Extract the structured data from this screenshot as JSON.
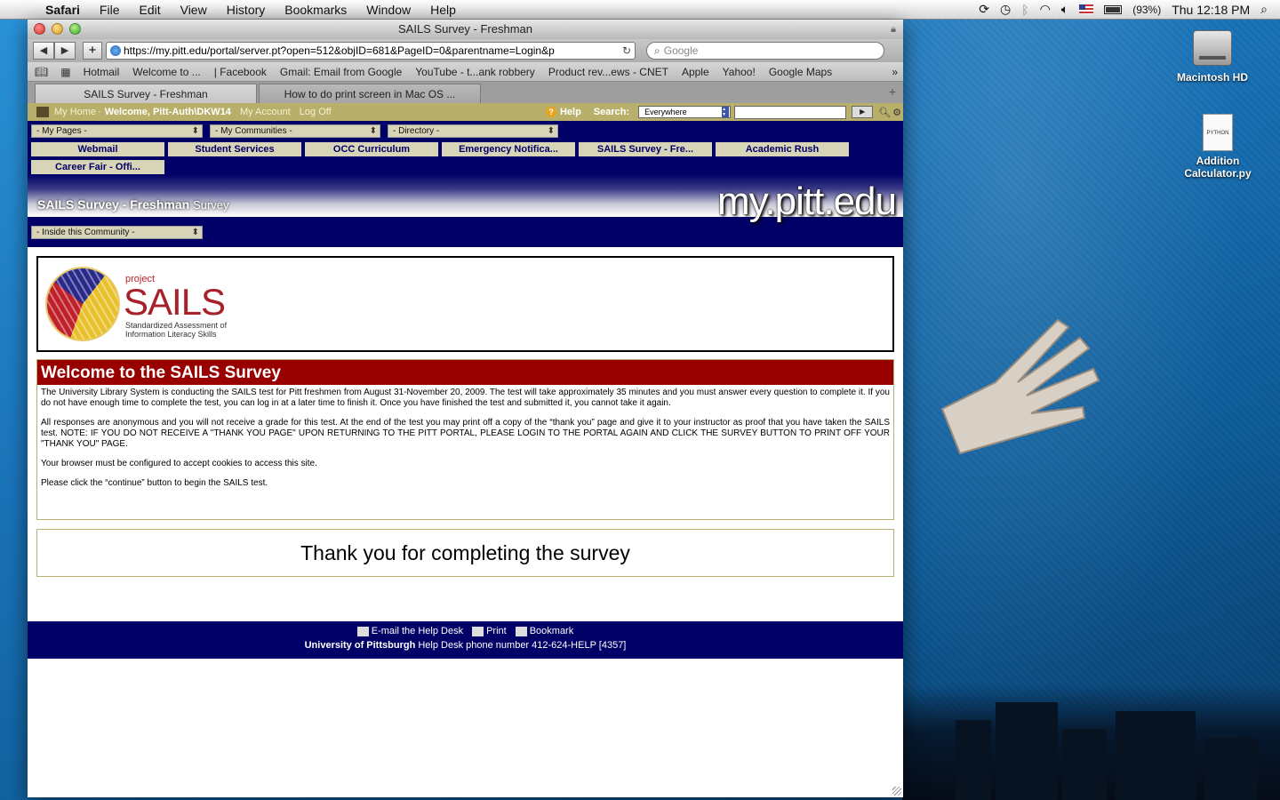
{
  "menubar": {
    "app_name": "Safari",
    "menus": [
      "File",
      "Edit",
      "View",
      "History",
      "Bookmarks",
      "Window",
      "Help"
    ],
    "battery": "(93%)",
    "clock": "Thu 12:18 PM"
  },
  "window": {
    "title": "SAILS Survey - Freshman",
    "url": "https://my.pitt.edu/portal/server.pt?open=512&objID=681&PageID=0&parentname=Login&p",
    "search_placeholder": "Google"
  },
  "bookmarks": [
    "Hotmail",
    "Welcome to ...",
    "| Facebook",
    "Gmail: Email from Google",
    "YouTube - t...ank robbery",
    "Product rev...ews - CNET",
    "Apple",
    "Yahoo!",
    "Google Maps"
  ],
  "tabs": [
    "SAILS Survey - Freshman",
    "How to do print screen in Mac OS ..."
  ],
  "portal": {
    "my_home": "My Home",
    "welcome": "Welcome, Pitt-Auth\\DKW14",
    "my_account": "My Account",
    "log_off": "Log Off",
    "help": "Help",
    "search_label": "Search:",
    "search_scope": "Everywhere",
    "dropdowns": [
      "- My Pages -",
      "- My Communities -",
      "- Directory -"
    ],
    "nav_buttons": [
      "Webmail",
      "Student Services",
      "OCC Curriculum",
      "Emergency Notifica...",
      "SAILS Survey - Fre...",
      "Academic Rush",
      "Career Fair - Offi..."
    ],
    "page_title": "SAILS Survey - Freshman",
    "page_title_sub": "Survey",
    "brand": "my.pitt.edu",
    "community_dropdown": "- Inside this Community -"
  },
  "logo": {
    "project": "project",
    "name": "SAILS",
    "tagline": "Standardized Assessment of Information Literacy Skills"
  },
  "welcome": {
    "heading": "Welcome to the SAILS Survey",
    "paragraphs": [
      "The University Library System is conducting the SAILS test for Pitt freshmen from August 31-November 20, 2009. The test will take approximately 35 minutes and you must answer every question to complete it. If you do not have enough time to complete the test, you can log in at a later time to finish it. Once you have finished the test and submitted it, you cannot take it again.",
      "All responses are anonymous and you will not receive a grade for this test. At the end of the test you may print off a copy of the “thank you” page and give it to your instructor as proof that you have taken the SAILS test.  NOTE: IF YOU DO NOT RECEIVE A \"THANK YOU PAGE\" UPON RETURNING TO THE PITT PORTAL, PLEASE LOGIN TO THE PORTAL AGAIN AND CLICK THE SURVEY BUTTON TO PRINT OFF YOUR \"THANK YOU\" PAGE.",
      "Your browser must be configured to accept cookies to access this site.",
      "Please click the “continue” button to begin the SAILS test."
    ]
  },
  "thanks": "Thank you for completing the survey",
  "footer": {
    "email": "E-mail the Help Desk",
    "print": "Print",
    "bookmark": "Bookmark",
    "univ": "University of Pittsburgh",
    "phone": "Help Desk phone number 412-624-HELP [4357]"
  },
  "desktop": {
    "hd_label": "Macintosh HD",
    "file_label_1": "Addition",
    "file_label_2": "Calculator.py",
    "file_badge": "PYTHON"
  }
}
